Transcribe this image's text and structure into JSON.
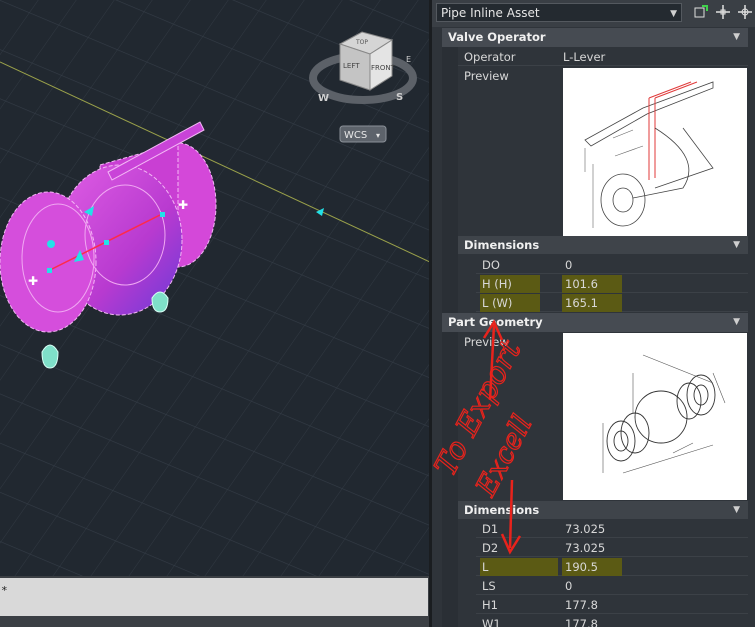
{
  "viewport": {
    "viewcube": {
      "top": "TOP",
      "left": "LEFT",
      "front": "FRONT",
      "compass": [
        "W",
        "S",
        "E"
      ]
    },
    "wcs_label": "WCS"
  },
  "command_line": {
    "prompt": "*"
  },
  "panel": {
    "asset_type": "Pipe Inline Asset",
    "valve_operator": {
      "title": "Valve Operator",
      "operator_label": "Operator",
      "operator_value": "L-Lever",
      "preview_label": "Preview",
      "dimensions": {
        "title": "Dimensions",
        "rows": [
          {
            "name": "DO",
            "value": "0",
            "highlight": false
          },
          {
            "name": "H (H)",
            "value": "101.6",
            "highlight": true
          },
          {
            "name": "L (W)",
            "value": "165.1",
            "highlight": true
          }
        ]
      }
    },
    "part_geometry": {
      "title": "Part Geometry",
      "preview_label": "Preview",
      "dimensions": {
        "title": "Dimensions",
        "rows": [
          {
            "name": "D1",
            "value": "73.025",
            "highlight": false
          },
          {
            "name": "D2",
            "value": "73.025",
            "highlight": false
          },
          {
            "name": "L",
            "value": "190.5",
            "highlight": true
          },
          {
            "name": "LS",
            "value": "0",
            "highlight": false
          },
          {
            "name": "H1",
            "value": "177.8",
            "highlight": false
          },
          {
            "name": "W1",
            "value": "177.8",
            "highlight": false
          }
        ]
      }
    }
  },
  "annotation": {
    "line1": "To Export",
    "line2": "Excell",
    "color": "#e8231c"
  },
  "colors": {
    "accent_magenta": "#d43cd8",
    "highlight": "#5b5a14",
    "panel_bg": "#2f343a"
  }
}
